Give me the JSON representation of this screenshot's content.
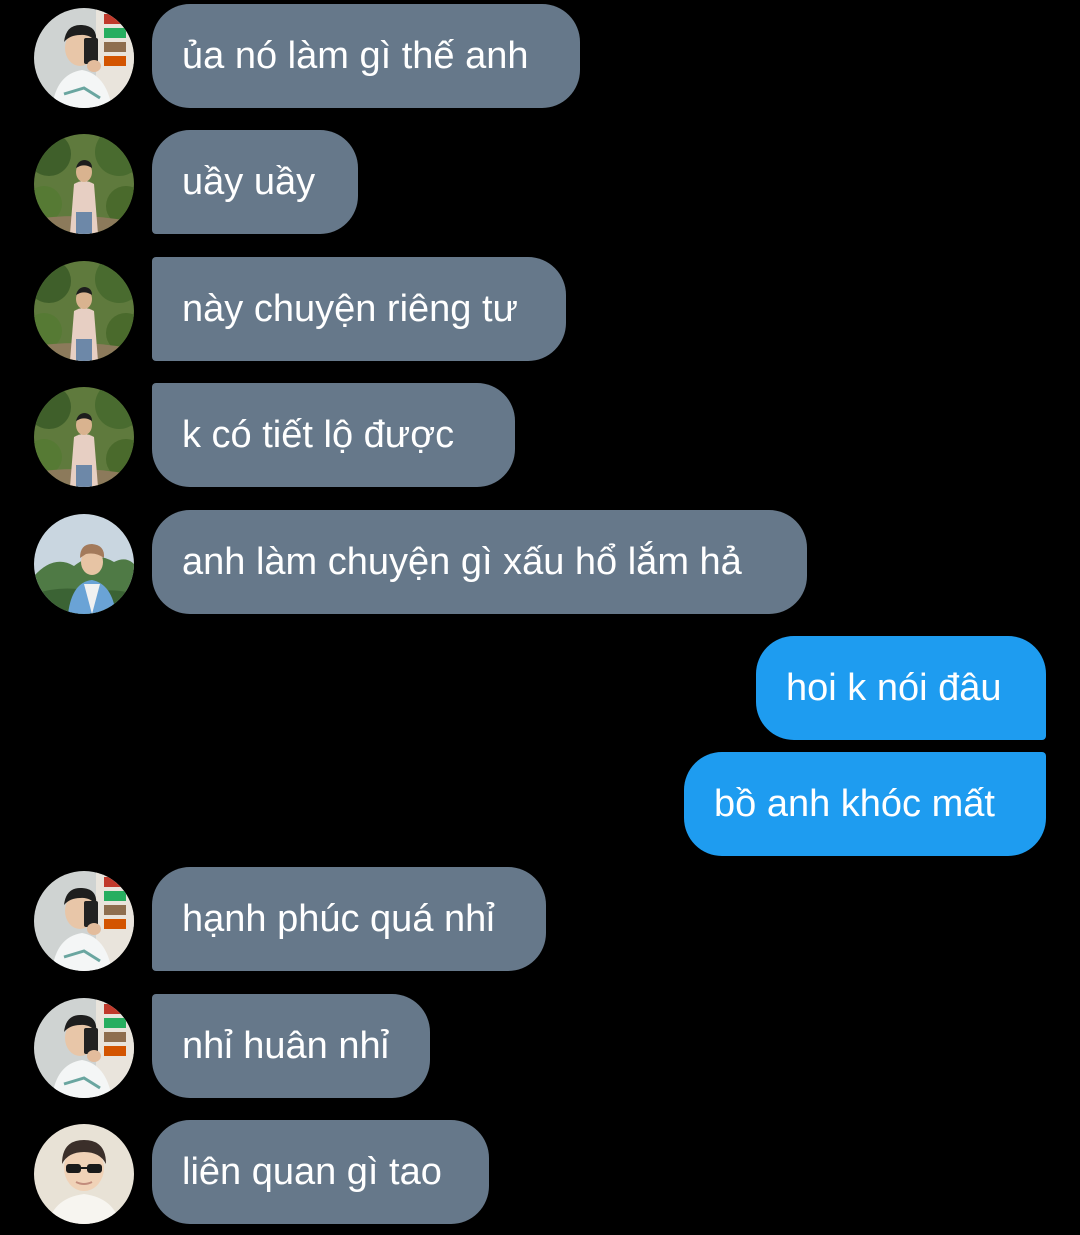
{
  "colors": {
    "background": "#000000",
    "incoming_bubble": "#66788a",
    "outgoing_bubble": "#1e9cf0",
    "text": "#ffffff"
  },
  "messages": [
    {
      "direction": "incoming",
      "sender_avatar": "avatar-mirror-selfie",
      "text": "ủa nó làm gì thế anh"
    },
    {
      "direction": "incoming",
      "sender_avatar": "avatar-garden-photo",
      "text": "uầy uầy"
    },
    {
      "direction": "incoming",
      "sender_avatar": "avatar-garden-photo",
      "text": "này chuyện riêng tư"
    },
    {
      "direction": "incoming",
      "sender_avatar": "avatar-garden-photo",
      "text": "k có tiết lộ được"
    },
    {
      "direction": "incoming",
      "sender_avatar": "avatar-mountain-photo",
      "text": "anh làm chuyện gì xấu hổ lắm hả"
    },
    {
      "direction": "outgoing",
      "text": "hoi k nói đâu"
    },
    {
      "direction": "outgoing",
      "text": "bồ anh khóc mất"
    },
    {
      "direction": "incoming",
      "sender_avatar": "avatar-mirror-selfie",
      "text": "hạnh phúc quá nhỉ"
    },
    {
      "direction": "incoming",
      "sender_avatar": "avatar-mirror-selfie",
      "text": "nhỉ huân nhỉ"
    },
    {
      "direction": "incoming",
      "sender_avatar": "avatar-sunglasses-photo",
      "text": "liên quan gì tao"
    }
  ]
}
